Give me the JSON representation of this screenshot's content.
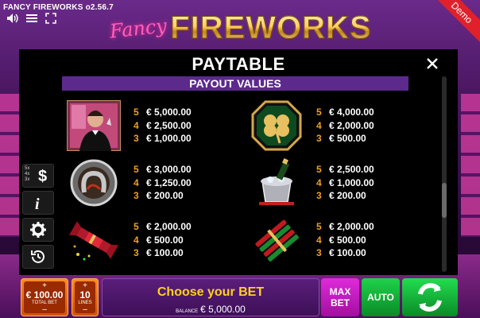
{
  "app": {
    "title": "FANCY FIREWORKS o2.56.7"
  },
  "logo": {
    "script_text": "Fancy",
    "main_text": "FIREWORKS"
  },
  "badge": {
    "demo": "Demo"
  },
  "icons": [
    "speaker-icon",
    "menu-icon",
    "fullscreen-icon",
    "close-icon",
    "dollar-icon",
    "info-icon",
    "gear-icon",
    "history-icon",
    "spin-icon"
  ],
  "paytable": {
    "title": "PAYTABLE",
    "section": "PAYOUT VALUES",
    "items": [
      {
        "symbol": "gentleman",
        "pays": [
          {
            "count": "5",
            "amount": "€ 5,000.00"
          },
          {
            "count": "4",
            "amount": "€ 2,500.00"
          },
          {
            "count": "3",
            "amount": "€ 1,000.00"
          }
        ]
      },
      {
        "symbol": "clover",
        "pays": [
          {
            "count": "5",
            "amount": "€ 4,000.00"
          },
          {
            "count": "4",
            "amount": "€ 2,000.00"
          },
          {
            "count": "3",
            "amount": "€ 500.00"
          }
        ]
      },
      {
        "symbol": "horseshoe",
        "pays": [
          {
            "count": "5",
            "amount": "€ 3,000.00"
          },
          {
            "count": "4",
            "amount": "€ 1,250.00"
          },
          {
            "count": "3",
            "amount": "€ 200.00"
          }
        ]
      },
      {
        "symbol": "champagne",
        "pays": [
          {
            "count": "5",
            "amount": "€ 2,500.00"
          },
          {
            "count": "4",
            "amount": "€ 1,000.00"
          },
          {
            "count": "3",
            "amount": "€ 200.00"
          }
        ]
      },
      {
        "symbol": "cracker",
        "pays": [
          {
            "count": "5",
            "amount": "€ 2,000.00"
          },
          {
            "count": "4",
            "amount": "€ 500.00"
          },
          {
            "count": "3",
            "amount": "€ 100.00"
          }
        ]
      },
      {
        "symbol": "rockets",
        "pays": [
          {
            "count": "5",
            "amount": "€ 2,000.00"
          },
          {
            "count": "4",
            "amount": "€ 500.00"
          },
          {
            "count": "3",
            "amount": "€ 100.00"
          }
        ]
      }
    ]
  },
  "side": {
    "bet_levels": "5x\n4x\n3x"
  },
  "bottom": {
    "total_bet_value": "€ 100.00",
    "total_bet_label": "TOTAL BET",
    "lines_value": "10",
    "lines_label": "LINES",
    "plus": "+",
    "minus": "–",
    "choose_bet": "Choose your BET",
    "balance_label": "BALANCE",
    "balance_value": "€ 5,000.00",
    "max_bet_line1": "MAX",
    "max_bet_line2": "BET",
    "auto": "AUTO"
  },
  "colors": {
    "accent_orange": "#f0a020",
    "section_purple": "#5b2a8c",
    "bet_yellow": "#ffd21e",
    "green": "#20d24a",
    "magenta": "#e02adc"
  }
}
